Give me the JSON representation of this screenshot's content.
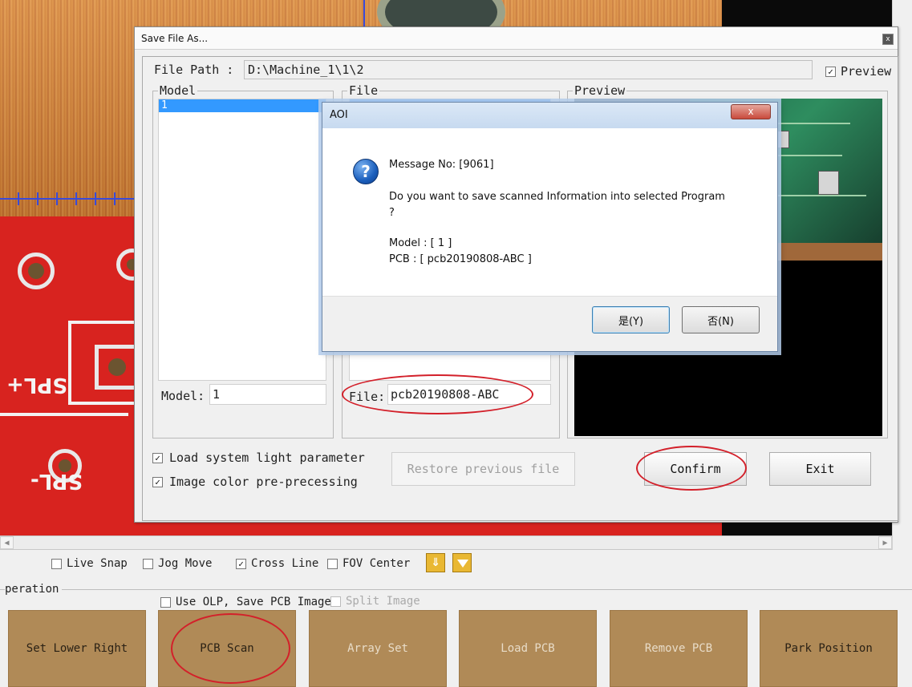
{
  "save_dialog": {
    "title": "Save File As...",
    "close_glyph": "x",
    "file_path_label": "File Path :",
    "file_path_value": "D:\\Machine_1\\1\\2",
    "preview_checkbox_label": "Preview",
    "preview_checked": true,
    "model_group_label": "Model",
    "model_list": [
      "1"
    ],
    "model_field_label": "Model:",
    "model_field_value": "1",
    "file_group_label": "File",
    "file_field_label": "File:",
    "file_field_value": "pcb20190808-ABC",
    "preview_group_label": "Preview",
    "load_light_label": "Load system light parameter",
    "load_light_checked": true,
    "color_preprocess_label": "Image color pre-precessing",
    "color_preprocess_checked": true,
    "restore_button": "Restore previous file",
    "confirm_button": "Confirm",
    "exit_button": "Exit"
  },
  "aoi_dialog": {
    "title": "AOI",
    "close_glyph": "x",
    "message_no": "Message No: [9061]",
    "question_line1": "Do you want to save scanned Information into selected Program",
    "question_line2": "?",
    "model_line": "Model : [ 1 ]",
    "pcb_line": "PCB : [ pcb20190808-ABC ]",
    "yes_button": "是(Y)",
    "no_button": "否(N)"
  },
  "check_bar": {
    "live_snap": {
      "label": "Live Snap",
      "checked": false
    },
    "jog_move": {
      "label": "Jog Move",
      "checked": false
    },
    "cross_line": {
      "label": "Cross Line",
      "checked": true
    },
    "fov_center": {
      "label": "FOV Center",
      "checked": false
    }
  },
  "operation": {
    "group_label": "peration",
    "use_olp_label": "Use OLP, Save PCB Image",
    "use_olp_checked": false,
    "split_image_label": "Split Image",
    "split_image_checked": false,
    "buttons": [
      {
        "label": "Set Lower Right",
        "enabled": true
      },
      {
        "label": "PCB Scan",
        "enabled": true
      },
      {
        "label": "Array Set",
        "enabled": false
      },
      {
        "label": "Load PCB",
        "enabled": false
      },
      {
        "label": "Remove PCB",
        "enabled": false
      },
      {
        "label": "Park Position",
        "enabled": true
      }
    ]
  },
  "board_silkscreen": [
    "SPL+",
    "SPL-"
  ],
  "colors": {
    "highlight_ellipse": "#d3202a",
    "op_button": "#b08a57",
    "selection": "#3399ff",
    "board_red": "#d8231f"
  }
}
